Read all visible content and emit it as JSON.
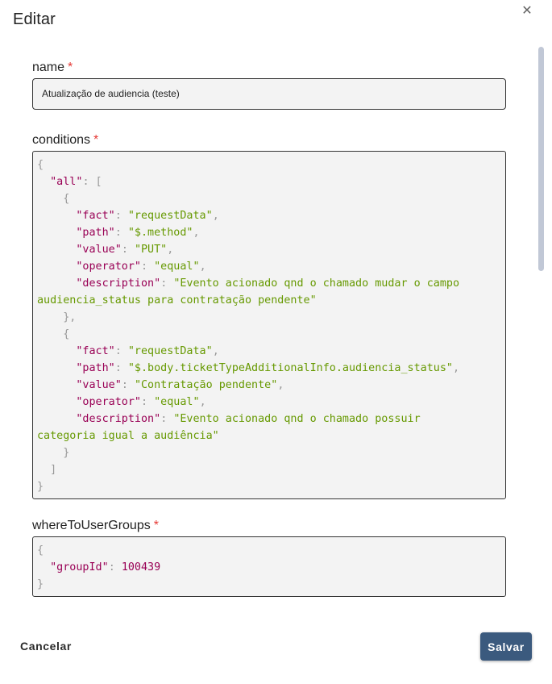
{
  "dialog": {
    "title": "Editar",
    "close_icon": "close-icon"
  },
  "form": {
    "name": {
      "label": "name",
      "required_mark": "*",
      "value": "Atualização de audiencia (teste)"
    },
    "conditions": {
      "label": "conditions",
      "required_mark": "*",
      "lines": [
        [
          [
            "p",
            "{"
          ]
        ],
        [
          [
            "p",
            "  "
          ],
          [
            "k",
            "\"all\""
          ],
          [
            "p",
            ": ["
          ]
        ],
        [
          [
            "p",
            "    {"
          ]
        ],
        [
          [
            "p",
            "      "
          ],
          [
            "k",
            "\"fact\""
          ],
          [
            "p",
            ": "
          ],
          [
            "s",
            "\"requestData\""
          ],
          [
            "p",
            ","
          ]
        ],
        [
          [
            "p",
            "      "
          ],
          [
            "k",
            "\"path\""
          ],
          [
            "p",
            ": "
          ],
          [
            "s",
            "\"$.method\""
          ],
          [
            "p",
            ","
          ]
        ],
        [
          [
            "p",
            "      "
          ],
          [
            "k",
            "\"value\""
          ],
          [
            "p",
            ": "
          ],
          [
            "s",
            "\"PUT\""
          ],
          [
            "p",
            ","
          ]
        ],
        [
          [
            "p",
            "      "
          ],
          [
            "k",
            "\"operator\""
          ],
          [
            "p",
            ": "
          ],
          [
            "s",
            "\"equal\""
          ],
          [
            "p",
            ","
          ]
        ],
        [
          [
            "p",
            "      "
          ],
          [
            "k",
            "\"description\""
          ],
          [
            "p",
            ": "
          ],
          [
            "s",
            "\"Evento acionado qnd o chamado mudar o campo"
          ]
        ],
        [
          [
            "s",
            "audiencia_status para contratação pendente\""
          ]
        ],
        [
          [
            "p",
            "    },"
          ]
        ],
        [
          [
            "p",
            "    {"
          ]
        ],
        [
          [
            "p",
            "      "
          ],
          [
            "k",
            "\"fact\""
          ],
          [
            "p",
            ": "
          ],
          [
            "s",
            "\"requestData\""
          ],
          [
            "p",
            ","
          ]
        ],
        [
          [
            "p",
            "      "
          ],
          [
            "k",
            "\"path\""
          ],
          [
            "p",
            ": "
          ],
          [
            "s",
            "\"$.body.ticketTypeAdditionalInfo.audiencia_status\""
          ],
          [
            "p",
            ","
          ]
        ],
        [
          [
            "p",
            "      "
          ],
          [
            "k",
            "\"value\""
          ],
          [
            "p",
            ": "
          ],
          [
            "s",
            "\"Contratação pendente\""
          ],
          [
            "p",
            ","
          ]
        ],
        [
          [
            "p",
            "      "
          ],
          [
            "k",
            "\"operator\""
          ],
          [
            "p",
            ": "
          ],
          [
            "s",
            "\"equal\""
          ],
          [
            "p",
            ","
          ]
        ],
        [
          [
            "p",
            "      "
          ],
          [
            "k",
            "\"description\""
          ],
          [
            "p",
            ": "
          ],
          [
            "s",
            "\"Evento acionado qnd o chamado possuir"
          ]
        ],
        [
          [
            "s",
            "categoria igual a audiência\""
          ]
        ],
        [
          [
            "p",
            "    }"
          ]
        ],
        [
          [
            "p",
            "  ]"
          ]
        ],
        [
          [
            "p",
            "}"
          ]
        ]
      ]
    },
    "whereToUserGroups": {
      "label": "whereToUserGroups",
      "required_mark": "*",
      "lines": [
        [
          [
            "p",
            "{"
          ]
        ],
        [
          [
            "p",
            "  "
          ],
          [
            "k",
            "\"groupId\""
          ],
          [
            "p",
            ": "
          ],
          [
            "n",
            "100439"
          ]
        ],
        [
          [
            "p",
            "}"
          ]
        ]
      ]
    }
  },
  "footer": {
    "cancel_label": "Cancelar",
    "save_label": "Salvar"
  },
  "colors": {
    "primary_button": "#3b5a7e",
    "required": "#e53935",
    "json_key": "#990055",
    "json_string": "#669900",
    "json_punct": "#999999"
  }
}
